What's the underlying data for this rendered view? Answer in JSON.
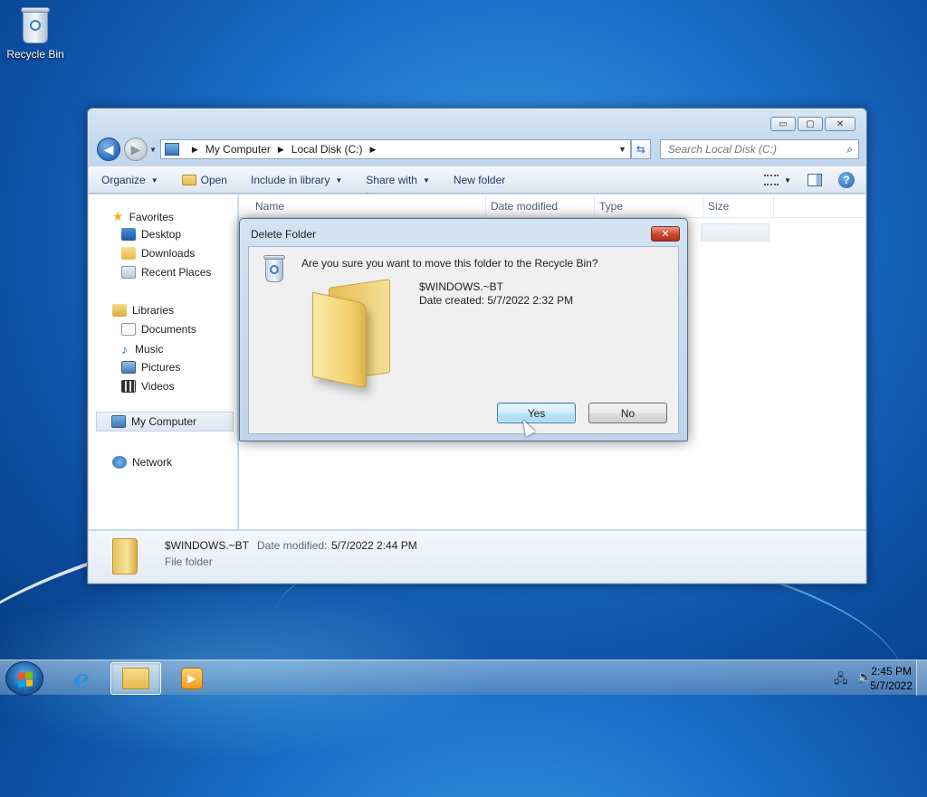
{
  "desktop": {
    "recycle_bin_label": "Recycle Bin"
  },
  "window": {
    "controls": {
      "minimize": "▭",
      "maximize": "▢",
      "close": "✕"
    },
    "address": {
      "crumbs": [
        "My Computer",
        "Local Disk (C:)"
      ]
    },
    "search": {
      "placeholder": "Search Local Disk (C:)"
    },
    "toolbar": {
      "organize": "Organize",
      "open": "Open",
      "include_in_library": "Include in library",
      "share_with": "Share with",
      "new_folder": "New folder"
    },
    "nav": {
      "favorites": "Favorites",
      "desktop": "Desktop",
      "downloads": "Downloads",
      "recent_places": "Recent Places",
      "libraries": "Libraries",
      "documents": "Documents",
      "music": "Music",
      "pictures": "Pictures",
      "videos": "Videos",
      "my_computer": "My Computer",
      "network": "Network"
    },
    "columns": {
      "name": "Name",
      "date_modified": "Date modified",
      "type": "Type",
      "size": "Size"
    },
    "details": {
      "name": "$WINDOWS.~BT",
      "date_label": "Date modified:",
      "date_value": "5/7/2022 2:44 PM",
      "type": "File folder"
    }
  },
  "dialog": {
    "title": "Delete Folder",
    "close": "✕",
    "question": "Are you sure you want to move this folder to the Recycle Bin?",
    "folder_name": "$WINDOWS.~BT",
    "date_created": "Date created: 5/7/2022 2:32 PM",
    "yes": "Yes",
    "no": "No"
  },
  "taskbar": {
    "time": "2:45 PM",
    "date": "5/7/2022",
    "tray_icons": [
      "network-icon",
      "volume-icon"
    ]
  },
  "colors": {
    "accent": "#1a6ec9",
    "close_red": "#c8462f",
    "selection": "#bee6fd"
  }
}
